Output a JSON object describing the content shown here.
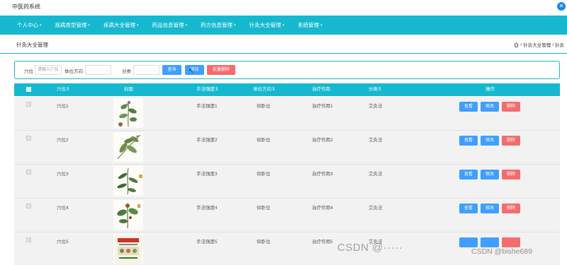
{
  "app": {
    "title": "中医药系统"
  },
  "nav": [
    {
      "label": "个人中心"
    },
    {
      "label": "疾病类型管理"
    },
    {
      "label": "疾病大全管理"
    },
    {
      "label": "药品信息管理"
    },
    {
      "label": "药方信息管理"
    },
    {
      "label": "针灸大全管理"
    },
    {
      "label": "系统管理"
    }
  ],
  "page": {
    "title": "针灸大全管理",
    "breadcrumb": [
      "针灸大全管理",
      "针灸"
    ]
  },
  "filter": {
    "label_xuewei": "穴位",
    "placeholder_xuewei": "请输入穴位",
    "label_direction": "体位方向",
    "label_category": "分类",
    "search_label": "查询",
    "add_label": "添加",
    "batch_delete_label": "批量删除"
  },
  "table": {
    "headers": [
      "穴位⇕",
      "封面",
      "手法强度⇕",
      "体位方向⇕",
      "治疗作用",
      "分类⇕",
      "操作"
    ],
    "actions": {
      "view": "查看",
      "edit": "修改",
      "delete": "删除"
    },
    "rows": [
      {
        "xuewei": "穴位1",
        "intensity": "手法强度1",
        "direction": "仰卧位",
        "effect": "治疗作用1",
        "category": "艾灸法"
      },
      {
        "xuewei": "穴位2",
        "intensity": "手法强度2",
        "direction": "仰卧位",
        "effect": "治疗作用2",
        "category": "艾灸法"
      },
      {
        "xuewei": "穴位3",
        "intensity": "手法强度3",
        "direction": "仰卧位",
        "effect": "治疗作用3",
        "category": "艾灸法"
      },
      {
        "xuewei": "穴位4",
        "intensity": "手法强度4",
        "direction": "仰卧位",
        "effect": "治疗作用4",
        "category": "艾灸法"
      },
      {
        "xuewei": "穴位5",
        "intensity": "手法强度5",
        "direction": "仰卧位",
        "effect": "治疗作用5",
        "category": "艾灸法"
      }
    ]
  },
  "watermark": {
    "left": "CSDN @·····",
    "right": "CSDN @bishe689"
  },
  "colors": {
    "primary": "#16b8d0",
    "blue": "#409eff",
    "red": "#f56c6c",
    "row_bg": "#f2f2f2"
  }
}
